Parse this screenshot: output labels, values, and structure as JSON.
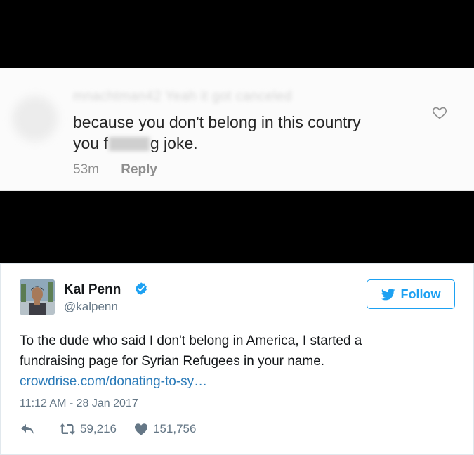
{
  "comment": {
    "blurred_username": "mnachtman42 Yeah it got canceled",
    "line1": "because you don't belong in this country",
    "line2_start": "you f",
    "line2_end": "g joke.",
    "time": "53m",
    "reply_label": "Reply"
  },
  "tweet": {
    "name": "Kal Penn",
    "handle": "@kalpenn",
    "follow_label": "Follow",
    "text_line1": "To the dude who said I don't belong in America, I started a",
    "text_line2": "fundraising page for Syrian Refugees in your name.",
    "link": "crowdrise.com/donating-to-sy…",
    "timestamp": "11:12 AM - 28 Jan 2017",
    "retweets": "59,216",
    "likes": "151,756"
  },
  "colors": {
    "twitter_blue": "#1da1f2",
    "link_blue": "#2b7bb9",
    "secondary_gray": "#657786",
    "redaction_black": "#000000"
  },
  "icons": [
    "heart-outline-icon",
    "verified-icon",
    "twitter-bird-icon",
    "reply-icon",
    "retweet-icon",
    "heart-icon"
  ]
}
